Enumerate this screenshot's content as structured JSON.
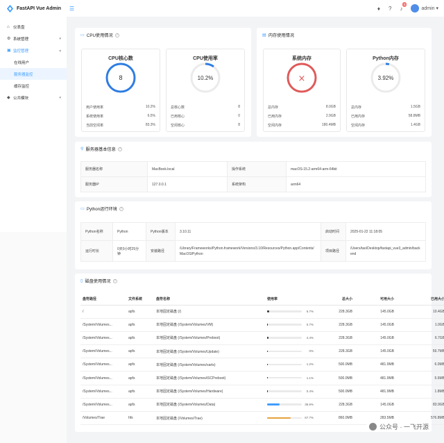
{
  "header": {
    "title": "FastAPI Vue Admin",
    "user": "admin",
    "badge": "5"
  },
  "sidebar": {
    "items": [
      {
        "label": "仪表盘"
      },
      {
        "label": "系统管理"
      },
      {
        "label": "监控管理"
      },
      {
        "label": "在线用户"
      },
      {
        "label": "服务器监控"
      },
      {
        "label": "缓存监控"
      },
      {
        "label": "公共模块"
      }
    ]
  },
  "cpu": {
    "title": "CPU使用情况",
    "cores": {
      "title": "CPU核心数",
      "value": "8",
      "rows": [
        [
          "用户使用率",
          "10.2%"
        ],
        [
          "系统使用率",
          "6.5%"
        ],
        [
          "当前空闲率",
          "83.3%"
        ]
      ]
    },
    "usage": {
      "title": "CPU使用率",
      "value": "10.2%",
      "percent": 10.2,
      "rows": [
        [
          "总核心数",
          "8"
        ],
        [
          "已用核心",
          "0"
        ],
        [
          "空闲核心",
          "8"
        ]
      ]
    }
  },
  "memory": {
    "title": "内存使用情况",
    "sys": {
      "title": "系统内存",
      "symbol": "×",
      "rows": [
        [
          "总内存",
          "8.0GB"
        ],
        [
          "已用内存",
          "2.9GB"
        ],
        [
          "空闲内存",
          "180.4MB"
        ]
      ]
    },
    "py": {
      "title": "Python内存",
      "value": "3.92%",
      "percent": 3.92,
      "rows": [
        [
          "总内存",
          "1.5GB"
        ],
        [
          "已用内存",
          "58.8MB"
        ],
        [
          "空闲内存",
          "1.4GB"
        ]
      ]
    }
  },
  "server": {
    "title": "服务器基本信息",
    "rows": [
      [
        "服务器名称",
        "MacBook.local",
        "操作系统",
        "macOS-15.2-arm64-arm-64bit"
      ],
      [
        "服务器IP",
        "127.0.0.1",
        "系统架构",
        "arm64"
      ]
    ]
  },
  "python": {
    "title": "Python运行环境",
    "name_label": "Python名称",
    "name": "Python",
    "ver_label": "Python版本",
    "ver": "3.10.11",
    "start_label": "启动时间",
    "start": "2025-01-22 11:18:05",
    "run_label": "运行时长",
    "run": "0天0小时25分钟",
    "install_label": "安装路径",
    "install": "/Library/Frameworks/Python.framework/Versions/3.10/Resources/Python.app/Contents/MacOS/Python",
    "proj_label": "项目路径",
    "proj": "/Users/tao/Desktop/fastapi_vue3_admin/backend"
  },
  "disk": {
    "title": "磁盘使用情况",
    "headers": [
      "盘符路径",
      "文件系统",
      "盘符名称",
      "使用率",
      "总大小",
      "可用大小",
      "已用大小"
    ],
    "rows": [
      {
        "path": "/",
        "fs": "apfs",
        "name": "本地固定磁盘 (/)",
        "pct": "6.7%",
        "v": 6.7,
        "color": "#333333",
        "total": "228.3GB",
        "free": "145.0GB",
        "used": "10.4GB"
      },
      {
        "path": "/System/Volumes...",
        "fs": "apfs",
        "name": "本地固定磁盘 (/System/Volumes/VM)",
        "pct": "0.7%",
        "v": 0.7,
        "color": "#333333",
        "total": "228.3GB",
        "free": "145.0GB",
        "used": "1.0GB"
      },
      {
        "path": "/System/Volumes...",
        "fs": "apfs",
        "name": "本地固定磁盘 (/System/Volumes/Preboot)",
        "pct": "4.4%",
        "v": 4.4,
        "color": "#333333",
        "total": "228.3GB",
        "free": "145.0GB",
        "used": "6.7GB"
      },
      {
        "path": "/System/Volumes...",
        "fs": "apfs",
        "name": "本地固定磁盘 (/System/Volumes/Update)",
        "pct": "0%",
        "v": 0,
        "color": "#333333",
        "total": "228.3GB",
        "free": "145.0GB",
        "used": "59.7MB"
      },
      {
        "path": "/System/Volumes...",
        "fs": "apfs",
        "name": "本地固定磁盘 (/System/Volumes/xarts)",
        "pct": "1.2%",
        "v": 1.2,
        "color": "#333333",
        "total": "500.0MB",
        "free": "481.9MB",
        "used": "6.0MB"
      },
      {
        "path": "/System/Volumes...",
        "fs": "apfs",
        "name": "本地固定磁盘 (/System/Volumes/iSCPreboot)",
        "pct": "1.1%",
        "v": 1.1,
        "color": "#333333",
        "total": "500.0MB",
        "free": "481.9MB",
        "used": "5.6MB"
      },
      {
        "path": "/System/Volumes...",
        "fs": "apfs",
        "name": "本地固定磁盘 (/System/Volumes/Hardware)",
        "pct": "0.4%",
        "v": 0.4,
        "color": "#333333",
        "total": "500.0MB",
        "free": "481.9MB",
        "used": "1.8MB"
      },
      {
        "path": "/System/Volumes...",
        "fs": "apfs",
        "name": "本地固定磁盘 (/System/Volumes/Data)",
        "pct": "36.6%",
        "v": 36.6,
        "color": "#409eff",
        "total": "228.3GB",
        "free": "145.0GB",
        "used": "83.9GB"
      },
      {
        "path": "/Volumes/Trae",
        "fs": "hfs",
        "name": "本地固定磁盘 (/Volumes/Trae)",
        "pct": "67.7%",
        "v": 67.7,
        "color": "#e6a23c",
        "total": "860.0MB",
        "free": "283.5MB",
        "used": "576.8MB"
      }
    ]
  },
  "watermark": "公众号 · 一飞开源"
}
